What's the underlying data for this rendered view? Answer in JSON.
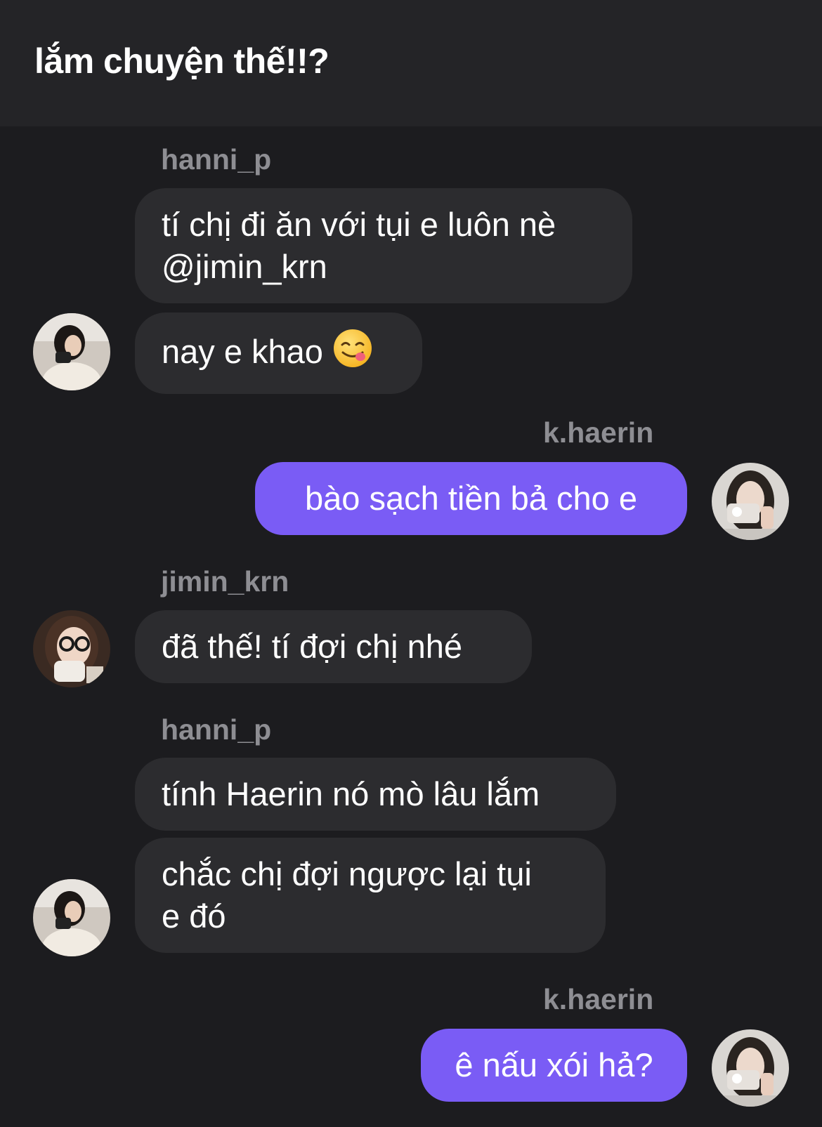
{
  "header": {
    "title": "lắm chuyện thế!!?"
  },
  "messages": [
    {
      "sender": "hanni_p",
      "text_lines": [
        "tí chị đi ăn với tụi e luôn nè",
        "@jimin_krn"
      ]
    },
    {
      "text": "nay e khao",
      "emoji": "yum-face-emoji"
    },
    {
      "sender": "k.haerin",
      "text": "bào sạch tiền bả cho e"
    },
    {
      "sender": "jimin_krn",
      "text": "đã thế! tí đợi chị nhé"
    },
    {
      "sender": "hanni_p",
      "text": "tính Haerin nó mò lâu lắm"
    },
    {
      "text_lines": [
        "chắc chị đợi ngược lại tụi",
        "e đó"
      ]
    },
    {
      "sender": "k.haerin",
      "text": "ê nấu xói hả?"
    }
  ],
  "colors": {
    "background": "#1c1c1f",
    "header": "#242427",
    "incoming_bubble": "#2c2c2f",
    "outgoing_bubble": "#7a5cf5",
    "sender_name": "#8e8e93"
  }
}
